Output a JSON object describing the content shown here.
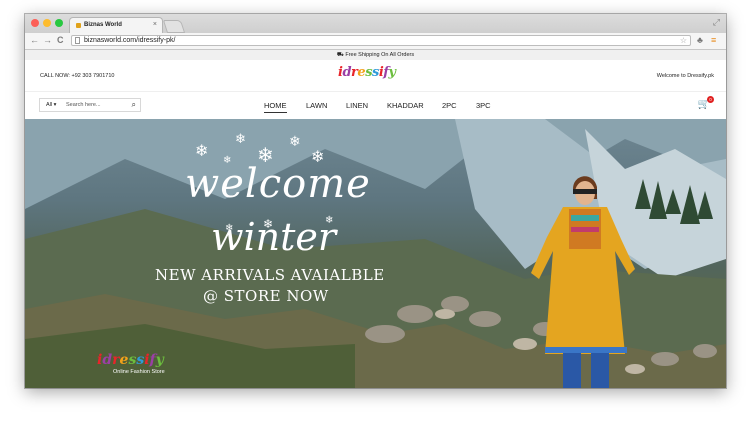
{
  "browser": {
    "tab_title": "Biznas World",
    "tab_close": "×",
    "url": "biznasworld.com/idressify-pk/",
    "back": "←",
    "forward": "→",
    "reload": "C"
  },
  "site": {
    "shipping_notice": "Free Shipping On All Orders",
    "call_now": "CALL NOW: +92 303 7901710",
    "logo_text": "idressify",
    "welcome": "Welcome to Dressify.pk",
    "search": {
      "category": "All",
      "placeholder": "Search here..."
    },
    "menu": [
      "HOME",
      "LAWN",
      "LINEN",
      "KHADDAR",
      "2PC",
      "3PC"
    ],
    "cart_count": "0"
  },
  "banner": {
    "line1": "welcome",
    "line2": "winter",
    "line3": "NEW ARRIVALS AVAIALBLE",
    "line4": "@ STORE NOW",
    "logo": "idressify",
    "logo_sub": "Online Fashion Store"
  },
  "colors": {
    "accent": "#e02020",
    "logo_red": "#e8242a",
    "logo_green": "#6cbe3e",
    "logo_purple": "#9b3fa5",
    "logo_orange": "#f3a21a"
  },
  "icons": {
    "truck": "truck-icon",
    "search": "search-icon",
    "cart": "cart-icon",
    "star": "star-icon"
  }
}
